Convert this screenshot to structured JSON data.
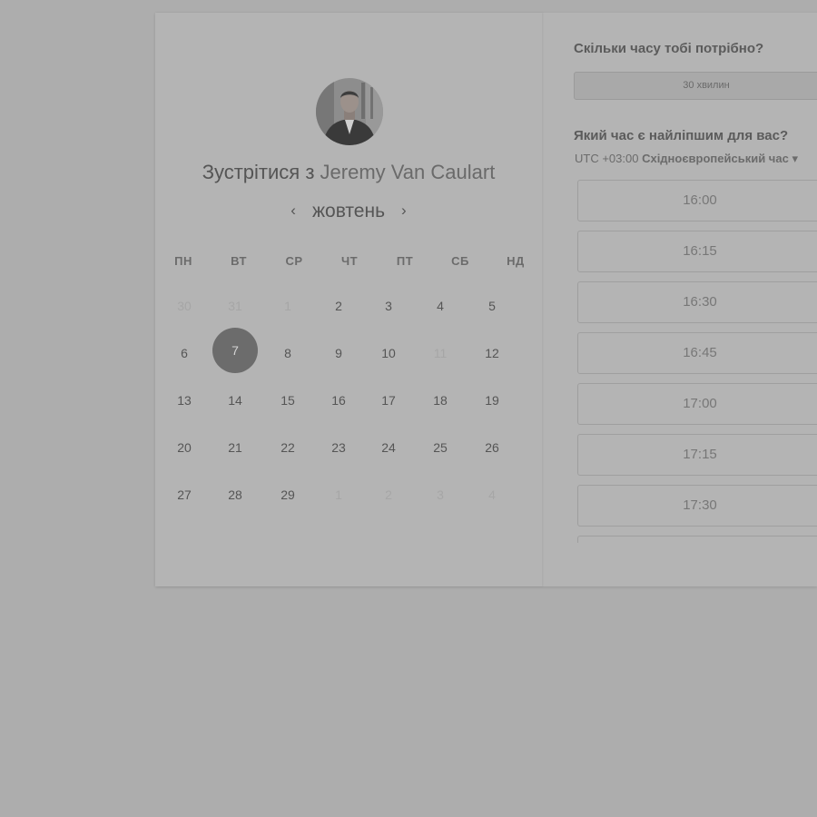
{
  "meeting": {
    "title_prefix": "Зустрітися з",
    "host_name": "Jeremy Van Caulart"
  },
  "calendar": {
    "month_label": "жовтень",
    "prev_icon": "‹",
    "next_icon": "›",
    "weekdays": [
      "ПН",
      "ВТ",
      "СР",
      "ЧТ",
      "ПТ",
      "СБ",
      "НД"
    ],
    "weeks": [
      [
        {
          "d": "30",
          "muted": true
        },
        {
          "d": "31",
          "muted": true
        },
        {
          "d": "1",
          "muted": true
        },
        {
          "d": "2"
        },
        {
          "d": "3"
        },
        {
          "d": "4"
        },
        {
          "d": "5"
        }
      ],
      [
        {
          "d": "6"
        },
        {
          "d": "7",
          "selected": true
        },
        {
          "d": "8"
        },
        {
          "d": "9"
        },
        {
          "d": "10"
        },
        {
          "d": "11",
          "muted": true
        },
        {
          "d": "12"
        }
      ],
      [
        {
          "d": "13"
        },
        {
          "d": "14"
        },
        {
          "d": "15"
        },
        {
          "d": "16"
        },
        {
          "d": "17"
        },
        {
          "d": "18"
        },
        {
          "d": "19"
        }
      ],
      [
        {
          "d": "20"
        },
        {
          "d": "21"
        },
        {
          "d": "22"
        },
        {
          "d": "23"
        },
        {
          "d": "24"
        },
        {
          "d": "25"
        },
        {
          "d": "26"
        }
      ],
      [
        {
          "d": "27"
        },
        {
          "d": "28"
        },
        {
          "d": "29"
        },
        {
          "d": "1",
          "muted": true
        },
        {
          "d": "2",
          "muted": true
        },
        {
          "d": "3",
          "muted": true
        },
        {
          "d": "4",
          "muted": true
        }
      ]
    ]
  },
  "booking": {
    "duration_question": "Скільки часу тобі потрібно?",
    "duration_value": "30 хвилин",
    "time_question": "Який час є найліпшим для вас?",
    "tz_offset": "UTC +03:00",
    "tz_name": "Східноєвропейський час",
    "tz_icon": "▾",
    "slots": [
      "16:00",
      "16:15",
      "16:30",
      "16:45",
      "17:00",
      "17:15",
      "17:30",
      ""
    ]
  },
  "colors": {
    "selected_day": "#6c6c6c",
    "background": "#adadad"
  }
}
